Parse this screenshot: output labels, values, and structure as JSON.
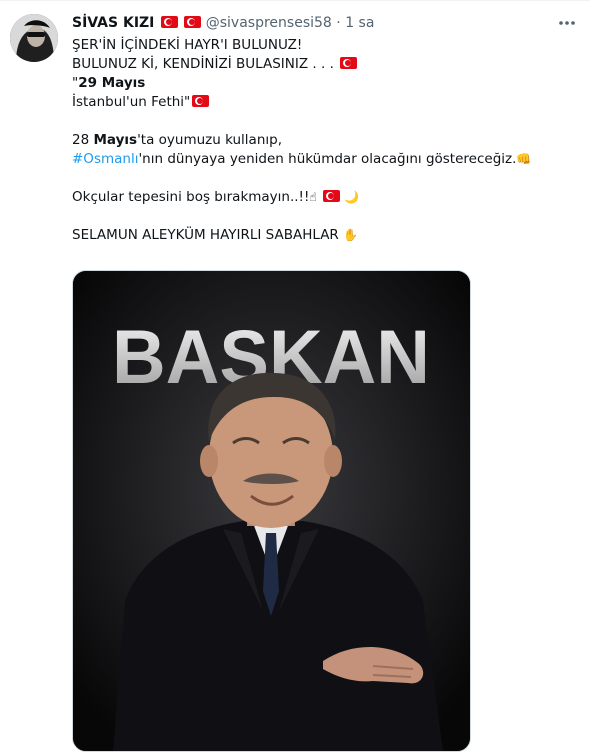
{
  "author": {
    "display_name": "SİVAS KIZI",
    "handle": "@sivasprensesi58",
    "separator": "·",
    "time": "1 sa",
    "avatar_icon": "profile-avatar",
    "flag_icon": "turkish-flag-icon"
  },
  "more_icon": "more-horizontal-icon",
  "tweet": {
    "line1": "ŞER'İN İÇİNDEKİ HAYR'I BULUNUZ!",
    "line2": "BULUNUZ Kİ, KENDİNİZİ BULASINIZ . . .",
    "line3_quote": "\"",
    "line3_bold": "29 Mayıs",
    "line4": "İstanbul'un Fethi\"",
    "line5_pre": "28 ",
    "line5_bold": "Mayıs",
    "line5_post": "'ta oyumuzu kullanıp,",
    "hashtag": "#Osmanlı",
    "line6_post": "'nın dünyaya yeniden hükümdar olacağını göstereceğiz.",
    "line7": "Okçular tepesini boş bırakmayın..!!",
    "line8": "SELAMUN ALEYKÜM HAYIRLI SABAHLAR",
    "fist_emoji": "👊",
    "point_emoji": "☝",
    "moon_emoji": "🌙",
    "hand_emoji": "✋"
  },
  "media": {
    "headline": "BAŞKAN"
  },
  "colors": {
    "link": "#1d9bf0",
    "secondary_text": "#536471",
    "flag_red": "#e30a17"
  }
}
